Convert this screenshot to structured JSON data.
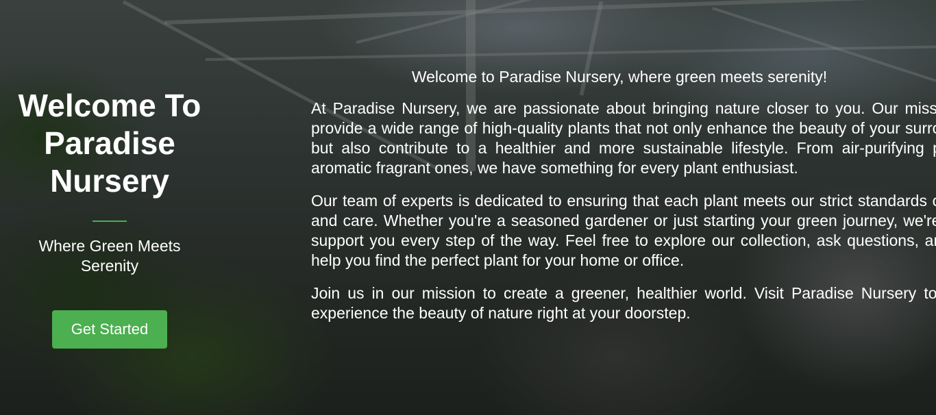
{
  "hero": {
    "title": "Welcome To Paradise Nursery",
    "tagline": "Where Green Meets Serenity",
    "cta_label": "Get Started"
  },
  "about": {
    "intro": "Welcome to Paradise Nursery, where green meets serenity!",
    "paragraphs": [
      "At Paradise Nursery, we are passionate about bringing nature closer to you. Our mission is to provide a wide range of high-quality plants that not only enhance the beauty of your surroundings but also contribute to a healthier and more sustainable lifestyle. From air-purifying plants to aromatic fragrant ones, we have something for every plant enthusiast.",
      "Our team of experts is dedicated to ensuring that each plant meets our strict standards of quality and care. Whether you're a seasoned gardener or just starting your green journey, we're here to support you every step of the way. Feel free to explore our collection, ask questions, and let us help you find the perfect plant for your home or office.",
      "Join us in our mission to create a greener, healthier world. Visit Paradise Nursery today and experience the beauty of nature right at your doorstep."
    ]
  },
  "colors": {
    "accent": "#4caf50",
    "text": "#ffffff"
  }
}
